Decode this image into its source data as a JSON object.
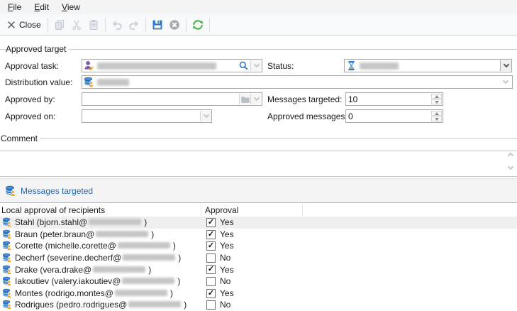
{
  "menu": {
    "items": [
      "File",
      "Edit",
      "View"
    ]
  },
  "toolbar": {
    "close_label": "Close",
    "buttons": [
      "close",
      "copy",
      "cut",
      "paste",
      "undo",
      "redo",
      "save",
      "cancel",
      "refresh"
    ]
  },
  "form": {
    "group_title": "Approved target",
    "fields": {
      "approval_task": {
        "label": "Approval task:",
        "value_redacted": true
      },
      "status": {
        "label": "Status:",
        "value_redacted": true
      },
      "distribution_value": {
        "label": "Distribution value:",
        "value_redacted": true
      },
      "approved_by": {
        "label": "Approved by:",
        "value": ""
      },
      "messages_targeted": {
        "label": "Messages targeted:",
        "value": "10"
      },
      "approved_on": {
        "label": "Approved on:",
        "value": ""
      },
      "approved_messages": {
        "label": "Approved messages:",
        "value": "0"
      }
    },
    "comment": {
      "title": "Comment",
      "value": ""
    }
  },
  "link_bar": {
    "label": "Messages targeted"
  },
  "table": {
    "columns": [
      "Local approval of recipients",
      "Approval"
    ],
    "strings": {
      "close_paren": ")"
    },
    "rows": [
      {
        "recipient": "Stahl (bjorn.stahl@",
        "domain_redacted": true,
        "approval": "Yes",
        "check_glyph": "✓",
        "selected": true
      },
      {
        "recipient": "Braun (peter.braun@",
        "domain_redacted": true,
        "approval": "Yes",
        "check_glyph": "✓",
        "selected": false
      },
      {
        "recipient": "Corette (michelle.corette@",
        "domain_redacted": true,
        "approval": "Yes",
        "check_glyph": "✓",
        "selected": false
      },
      {
        "recipient": "Decherf (severine.decherf@",
        "domain_redacted": true,
        "approval": "No",
        "check_glyph": "",
        "selected": false
      },
      {
        "recipient": "Drake (vera.drake@",
        "domain_redacted": true,
        "approval": "Yes",
        "check_glyph": "✓",
        "selected": false
      },
      {
        "recipient": "Iakoutiev (valery.iakoutiev@",
        "domain_redacted": true,
        "approval": "No",
        "check_glyph": "",
        "selected": false
      },
      {
        "recipient": "Montes (rodrigo.montes@",
        "domain_redacted": true,
        "approval": "Yes",
        "check_glyph": "✓",
        "selected": false
      },
      {
        "recipient": "Rodrigues (pedro.rodrigues@",
        "domain_redacted": true,
        "approval": "No",
        "check_glyph": "",
        "selected": false
      }
    ]
  },
  "colors": {
    "link_blue": "#2368b4",
    "save_blue": "#2a7ad2",
    "refresh_green": "#43ae49",
    "accent_orange": "#f5a31d",
    "icon_purple": "#7a5fae",
    "db_blue": "#2f7bc3"
  }
}
